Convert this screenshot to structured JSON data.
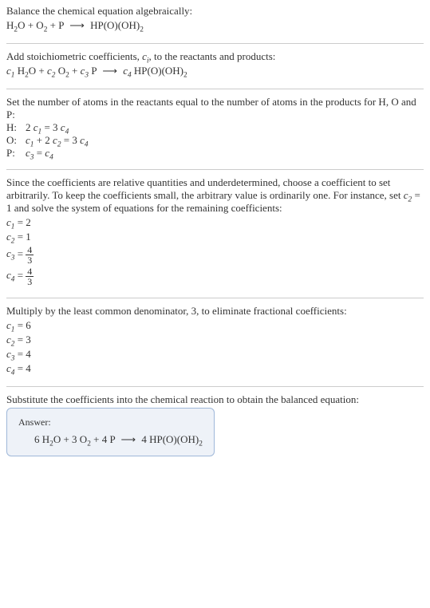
{
  "s1": {
    "line1": "Balance the chemical equation algebraically:"
  },
  "s2": {
    "line1": "Add stoichiometric coefficients, ",
    "ci": "c",
    "ci_sub": "i",
    "line1b": ", to the reactants and products:"
  },
  "s3": {
    "line1": "Set the number of atoms in the reactants equal to the number of atoms in the products for H, O and P:",
    "rows": [
      {
        "atom": "H:"
      },
      {
        "atom": "O:"
      },
      {
        "atom": "P:"
      }
    ]
  },
  "s4": {
    "t1": "Since the coefficients are relative quantities and underdetermined, choose a coefficient to set arbitrarily. To keep the coefficients small, the arbitrary value is ordinarily one. For instance, set ",
    "t2": " = 1 and solve the system of equations for the remaining coefficients:"
  },
  "s5": {
    "line1": "Multiply by the least common denominator, 3, to eliminate fractional coefficients:",
    "c1": "c",
    "c1s": "1",
    "v1": " = 6",
    "c2": "c",
    "c2s": "2",
    "v2": " = 3",
    "c3": "c",
    "c3s": "3",
    "v3": " = 4",
    "c4": "c",
    "c4s": "4",
    "v4": " = 4"
  },
  "s6": {
    "line1": "Substitute the coefficients into the chemical reaction to obtain the balanced equation:"
  },
  "answer": {
    "label": "Answer:"
  },
  "sym": {
    "arrow": "⟶",
    "H2O": {
      "a": "H",
      "s1": "2",
      "b": "O"
    },
    "O2": {
      "a": "O",
      "s1": "2"
    },
    "P": {
      "a": "P"
    },
    "HPOOH2": {
      "a": "HP(O)(OH)",
      "s1": "2"
    },
    "plus": " + ",
    "eq": " = ",
    "c": "c",
    "two": "2",
    "three": "3",
    "four": "4",
    "six": "6",
    "one": "1",
    "twoc1": "2 ",
    "c1p2c2": " + 2 "
  },
  "coef": {
    "c1": "1",
    "c2": "2",
    "c3": "3",
    "c4": "4"
  },
  "vals": {
    "v2": " = 2",
    "v1": " = 1",
    "eq": " = "
  },
  "frac": {
    "n": "4",
    "d": "3"
  }
}
